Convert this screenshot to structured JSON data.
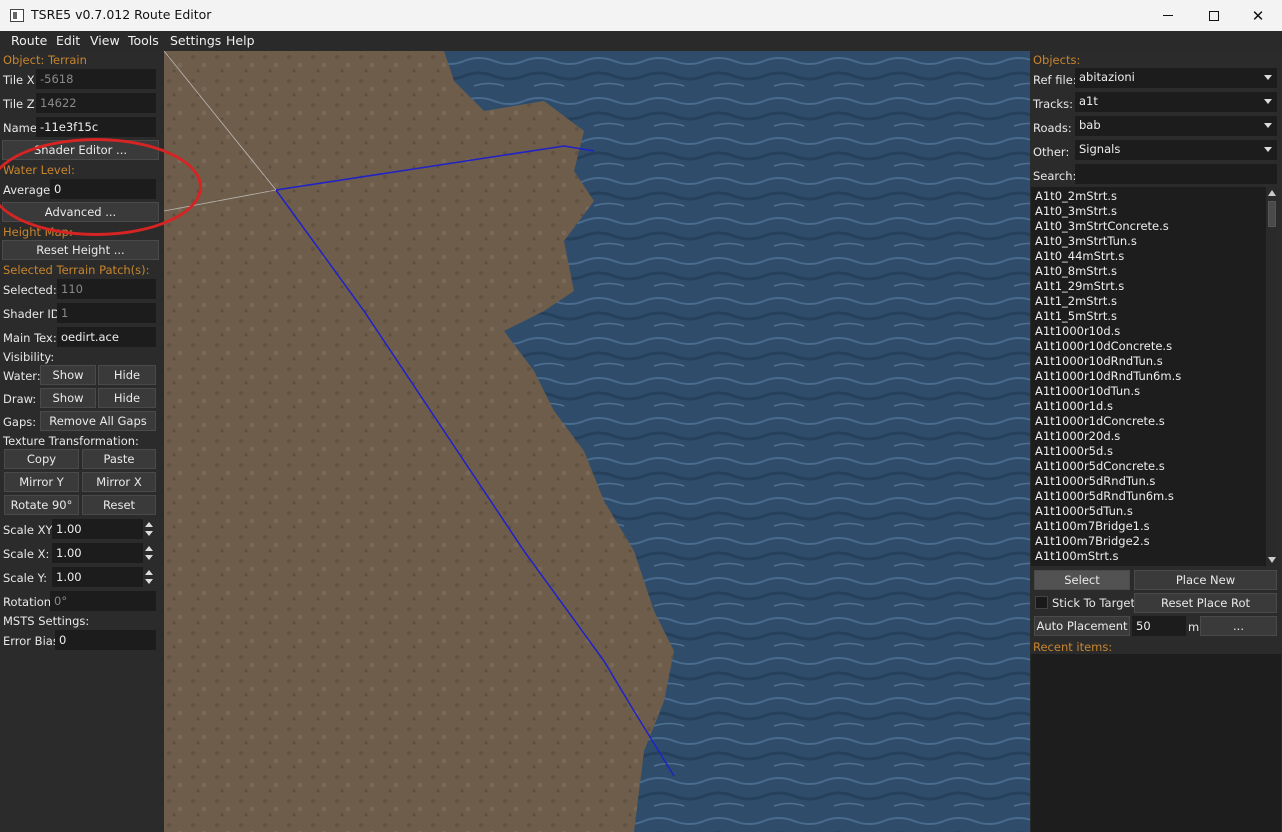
{
  "window": {
    "title": "TSRE5 v0.7.012 Route Editor"
  },
  "menu": [
    "Route",
    "Edit",
    "View",
    "Tools",
    "Settings",
    "Help"
  ],
  "left": {
    "object_section": "Object: Terrain",
    "tile_x_label": "Tile X:",
    "tile_x_value": "-5618",
    "tile_z_label": "Tile Z:",
    "tile_z_value": "14622",
    "name_label": "Name:",
    "name_value": "-11e3f15c",
    "shader_editor": "Shader Editor ...",
    "water_section": "Water Level:",
    "average_label": "Average:",
    "average_value": "0",
    "advanced": "Advanced ...",
    "height_section": "Height Map:",
    "reset_height": "Reset Height ...",
    "patch_section": "Selected Terrain Patch(s):",
    "selected_label": "Selected:",
    "selected_value": "110",
    "shader_id_label": "Shader ID:",
    "shader_id_value": "1",
    "main_tex_label": "Main Tex:",
    "main_tex_value": "oedirt.ace",
    "visibility_label": "Visibility:",
    "water_label": "Water:",
    "draw_label": "Draw:",
    "show": "Show",
    "hide": "Hide",
    "gaps_label": "Gaps:",
    "remove_gaps": "Remove All Gaps",
    "texture_label": "Texture Transformation:",
    "copy": "Copy",
    "paste": "Paste",
    "mirror_y": "Mirror Y",
    "mirror_x": "Mirror X",
    "rotate": "Rotate 90°",
    "reset": "Reset",
    "scale_xy_label": "Scale XY",
    "scale_xy_value": "1.00",
    "scale_x_label": "Scale X:",
    "scale_x_value": "1.00",
    "scale_y_label": "Scale Y:",
    "scale_y_value": "1.00",
    "rotation_label": "Rotation:",
    "rotation_value": "0°",
    "msts_label": "MSTS Settings:",
    "error_bias_label": "Error Bias:",
    "error_bias_value": "0"
  },
  "right": {
    "objects_section": "Objects:",
    "ref_file_label": "Ref file:",
    "ref_file_value": "abitazioni",
    "tracks_label": "Tracks:",
    "tracks_value": "a1t",
    "roads_label": "Roads:",
    "roads_value": "bab",
    "other_label": "Other:",
    "other_value": "Signals",
    "search_label": "Search:",
    "search_value": "",
    "items": [
      "A1t0_2mStrt.s",
      "A1t0_3mStrt.s",
      "A1t0_3mStrtConcrete.s",
      "A1t0_3mStrtTun.s",
      "A1t0_44mStrt.s",
      "A1t0_8mStrt.s",
      "A1t1_29mStrt.s",
      "A1t1_2mStrt.s",
      "A1t1_5mStrt.s",
      "A1t1000r10d.s",
      "A1t1000r10dConcrete.s",
      "A1t1000r10dRndTun.s",
      "A1t1000r10dRndTun6m.s",
      "A1t1000r10dTun.s",
      "A1t1000r1d.s",
      "A1t1000r1dConcrete.s",
      "A1t1000r20d.s",
      "A1t1000r5d.s",
      "A1t1000r5dConcrete.s",
      "A1t1000r5dRndTun.s",
      "A1t1000r5dRndTun6m.s",
      "A1t1000r5dTun.s",
      "A1t100m7Bridge1.s",
      "A1t100m7Bridge2.s",
      "A1t100mStrt.s"
    ],
    "select": "Select",
    "place_new": "Place New",
    "stick_to_target": "Stick To Target",
    "reset_place_rot": "Reset Place Rot",
    "auto_placement": "Auto Placement",
    "distance_value": "50",
    "unit": "m",
    "more": "...",
    "recent_section": "Recent items:"
  },
  "colors": {
    "accent": "#c8852e",
    "annotation": "#d62424",
    "track_line": "#1e22c8",
    "water": "#2f4d6b",
    "terrain": "#6e5d4b"
  }
}
